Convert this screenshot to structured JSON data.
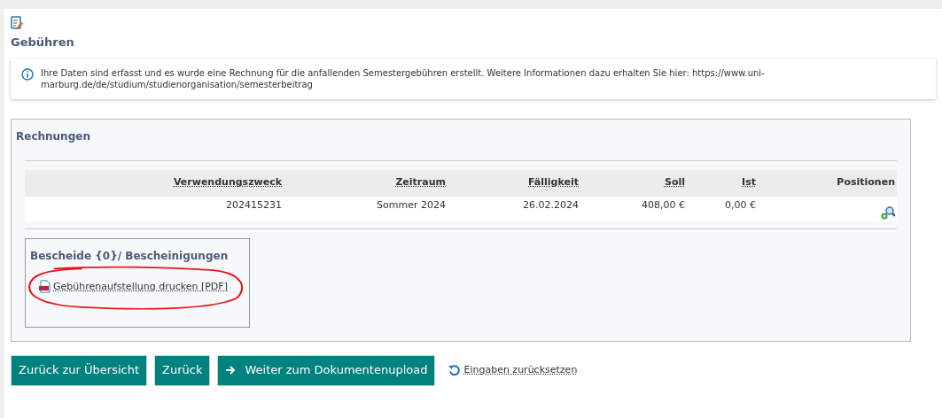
{
  "page": {
    "title": "Gebühren"
  },
  "info": {
    "text": "Ihre Daten sind erfasst und es wurde eine Rechnung für die anfallenden Semestergebühren erstellt. Weitere Informationen dazu erhalten Sie hier: https://www.uni-marburg.de/de/studium/studienorganisation/semesterbeitrag"
  },
  "invoices": {
    "title": "Rechnungen",
    "columns": [
      "Verwendungszweck",
      "Zeitraum",
      "Fälligkeit",
      "Soll",
      "Ist",
      "Positionen"
    ],
    "rows": [
      {
        "cells": [
          "202415231",
          "Sommer 2024",
          "26.02.2024",
          "408,00 €",
          "0,00 €"
        ]
      }
    ]
  },
  "documents": {
    "title": "Bescheide {0}/ Bescheinigungen",
    "link": "Gebührenaufstellung drucken [PDF]"
  },
  "buttons": [
    {
      "label": "Zurück zur Übersicht",
      "kind": "plain"
    },
    {
      "label": "Zurück",
      "kind": "plain"
    },
    {
      "label": "Weiter zum Dokumentenupload",
      "kind": "forward"
    }
  ],
  "reset_link": "Eingaben zurücksetzen"
}
